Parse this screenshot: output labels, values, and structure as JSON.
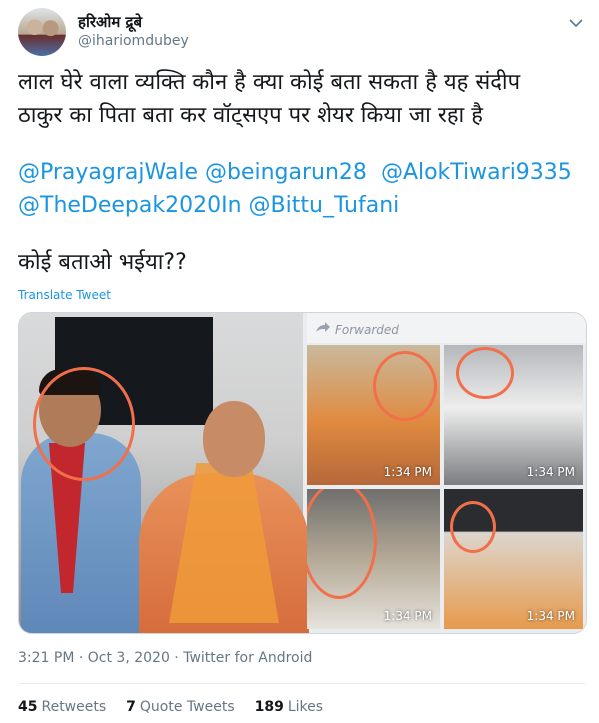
{
  "user": {
    "name": "हरिओम द्रूबे",
    "handle": "@ihariomdubey"
  },
  "tweet": {
    "text_line1": "लाल घेरे वाला व्यक्ति कौन है क्या कोई बता सकता है यह संदीप",
    "text_line2": "ठाकुर का पिता बता कर वॉट्सएप पर शेयर किया जा रहा है",
    "mentions": [
      "@PrayagrajWale",
      "@beingarun28",
      "@AlokTiwari9335",
      "@TheDeepak2020In",
      "@Bittu_Tufani"
    ],
    "question": "कोई बताओ भईया??",
    "translate_label": "Translate Tweet"
  },
  "media": {
    "forwarded_label": "Forwarded",
    "thumb_times": [
      "1:34 PM",
      "1:34 PM",
      "1:34 PM",
      "1:34 PM"
    ]
  },
  "meta": {
    "timestamp": "3:21 PM · Oct 3, 2020 · Twitter for Android"
  },
  "stats": {
    "retweets": "45",
    "retweets_label": "Retweets",
    "quotes": "7",
    "quotes_label": "Quote Tweets",
    "likes": "189",
    "likes_label": "Likes"
  },
  "icons": {
    "caret": "chevron-down-icon",
    "forwarded": "forward-arrow-icon"
  },
  "colors": {
    "link": "#1b95e0",
    "muted": "#657786",
    "circle_annotation": "#f26f4b"
  }
}
